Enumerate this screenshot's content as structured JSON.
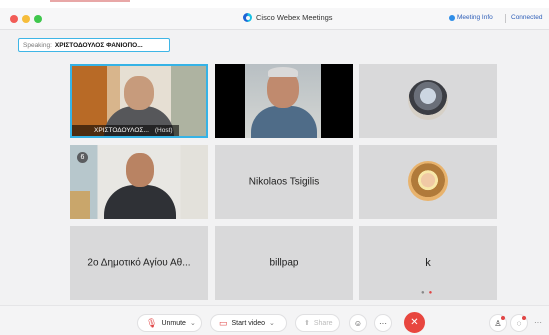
{
  "window": {
    "app_title": "Cisco Webex Meetings",
    "meeting_info": "Meeting Info",
    "separator": "|",
    "status": "Connected"
  },
  "speaking": {
    "label": "Speaking:",
    "name": "ΧΡΙΣΤΟΔΟΥΛΟΣ ΦΑΝΙΟΠΟ..."
  },
  "tiles": [
    {
      "type": "video",
      "caption": "ΧΡΙΣΤΟΔΟΥΛΟΣ...",
      "host_label": "(Host)",
      "active_speaker": true
    },
    {
      "type": "video"
    },
    {
      "type": "avatar"
    },
    {
      "type": "video",
      "badge": "6"
    },
    {
      "type": "name",
      "name": "Nikolaos Tsigilis"
    },
    {
      "type": "avatar"
    },
    {
      "type": "name",
      "name": "2ο Δημοτικό Αγίου Αθ..."
    },
    {
      "type": "name",
      "name": "billpap"
    },
    {
      "type": "name",
      "name": "k"
    }
  ],
  "controls": {
    "unmute": "Unmute",
    "start_video": "Start video",
    "share": "Share",
    "more": "···",
    "end": "✕",
    "chevron": "⌄"
  },
  "colors": {
    "active_speaker_border": "#36b3e6",
    "end_button": "#e8463f",
    "muted_red": "#e04545"
  },
  "icons": [
    "webex-logo-icon",
    "info-icon",
    "mic-off-icon",
    "camera-off-icon",
    "share-icon",
    "reactions-icon",
    "more-icon",
    "end-call-icon",
    "participants-icon",
    "chat-icon"
  ]
}
